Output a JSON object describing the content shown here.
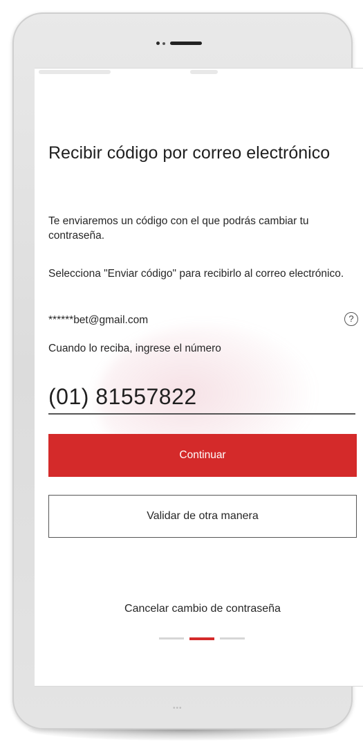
{
  "screen": {
    "title": "Recibir código por correo electrónico",
    "paragraph_1": "Te enviaremos un código con el que podrás cambiar tu contraseña.",
    "paragraph_2": "Selecciona \"Enviar código\" para recibirlo al correo electrónico.",
    "email": "******bet@gmail.com",
    "help_icon": "question-circle-icon",
    "help_glyph": "?",
    "paragraph_3": "Cuando lo reciba, ingrese el número",
    "code_field": {
      "value": "(01) 81557822"
    },
    "primary_button": "Continuar",
    "secondary_button": "Validar de otra manera",
    "cancel_link": "Cancelar cambio de contraseña",
    "pager": {
      "total": 3,
      "active_index": 1
    }
  },
  "colors": {
    "accent": "#d42a2a",
    "text": "#262626",
    "border": "#555555"
  }
}
